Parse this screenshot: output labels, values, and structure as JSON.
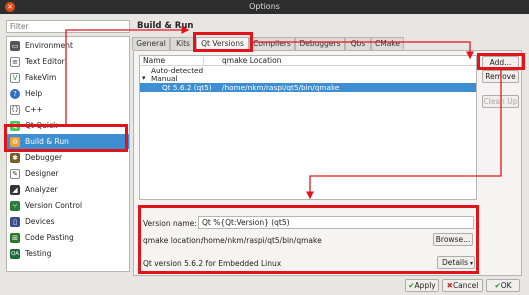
{
  "window": {
    "title": "Options"
  },
  "filter": {
    "placeholder": "Filter"
  },
  "sidebar": {
    "items": [
      {
        "label": "Environment",
        "icon": "monitor-icon"
      },
      {
        "label": "Text Editor",
        "icon": "text-editor-icon"
      },
      {
        "label": "FakeVim",
        "icon": "fakevim-icon"
      },
      {
        "label": "Help",
        "icon": "help-icon"
      },
      {
        "label": "C++",
        "icon": "cpp-icon"
      },
      {
        "label": "Qt Quick",
        "icon": "qt-quick-icon"
      },
      {
        "label": "Build & Run",
        "icon": "build-run-icon",
        "selected": true
      },
      {
        "label": "Debugger",
        "icon": "debugger-icon"
      },
      {
        "label": "Designer",
        "icon": "designer-icon"
      },
      {
        "label": "Analyzer",
        "icon": "analyzer-icon"
      },
      {
        "label": "Version Control",
        "icon": "version-control-icon"
      },
      {
        "label": "Devices",
        "icon": "devices-icon"
      },
      {
        "label": "Code Pasting",
        "icon": "code-pasting-icon"
      },
      {
        "label": "Testing",
        "icon": "testing-icon"
      }
    ]
  },
  "page": {
    "title": "Build & Run"
  },
  "tabs": [
    "General",
    "Kits",
    "Qt Versions",
    "Compilers",
    "Debuggers",
    "Qbs",
    "CMake"
  ],
  "tree": {
    "columns": [
      "Name",
      "qmake Location"
    ],
    "rows": [
      {
        "text": "Auto-detected"
      },
      {
        "text": "Manual",
        "expander": "▾"
      },
      {
        "name": "Qt 5.6.2 (qt5)",
        "location": "/home/nkm/raspi/qt5/bin/qmake",
        "selected": true
      }
    ]
  },
  "side_buttons": {
    "add": "Add...",
    "remove": "Remove",
    "clean_up": "Clean Up"
  },
  "details": {
    "version_name_label": "Version name:",
    "version_name_value": "Qt %{Qt:Version} (qt5)",
    "qmake_location_label": "qmake location:",
    "qmake_location_value": "/home/nkm/raspi/qt5/bin/qmake",
    "browse_label": "Browse...",
    "info_text": "Qt version 5.6.2 for Embedded Linux",
    "details_label": "Details"
  },
  "dialog_buttons": {
    "apply": "Apply",
    "cancel": "Cancel",
    "ok": "OK"
  },
  "colors": {
    "accent": "#3d8fd1",
    "annotation": "#e1141c"
  }
}
